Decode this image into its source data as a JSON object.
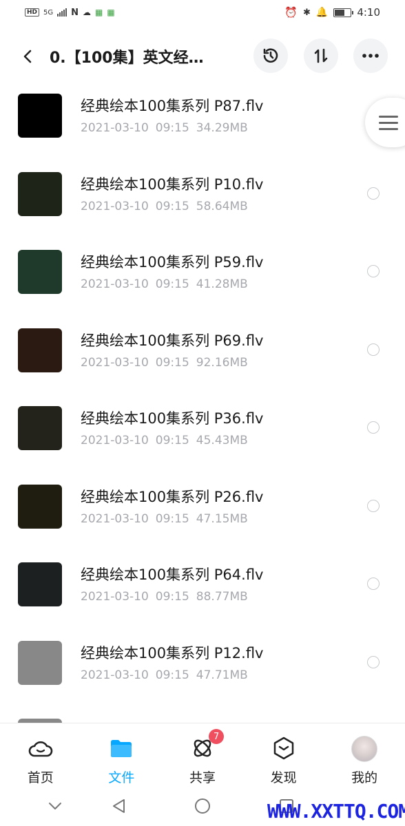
{
  "status_bar": {
    "left_chip": "HD",
    "network": "5G",
    "time": "4:10"
  },
  "header": {
    "back_icon": "chevron-left-icon",
    "title": "0.【100集】英文经…",
    "actions": [
      {
        "name": "history-icon"
      },
      {
        "name": "sort-icon"
      },
      {
        "name": "more-icon"
      }
    ]
  },
  "files": [
    {
      "name": "经典绘本100集系列 P87.flv",
      "date": "2021-03-10",
      "time": "09:15",
      "size": "34.29MB",
      "thumb_color": "#000000"
    },
    {
      "name": "经典绘本100集系列 P10.flv",
      "date": "2021-03-10",
      "time": "09:15",
      "size": "58.64MB",
      "thumb_color": "#1f2419"
    },
    {
      "name": "经典绘本100集系列 P59.flv",
      "date": "2021-03-10",
      "time": "09:15",
      "size": "41.28MB",
      "thumb_color": "#1f3a2a"
    },
    {
      "name": "经典绘本100集系列 P69.flv",
      "date": "2021-03-10",
      "time": "09:15",
      "size": "92.16MB",
      "thumb_color": "#2a1a12"
    },
    {
      "name": "经典绘本100集系列 P36.flv",
      "date": "2021-03-10",
      "time": "09:15",
      "size": "45.43MB",
      "thumb_color": "#23231b"
    },
    {
      "name": "经典绘本100集系列 P26.flv",
      "date": "2021-03-10",
      "time": "09:15",
      "size": "47.15MB",
      "thumb_color": "#1f1d10"
    },
    {
      "name": "经典绘本100集系列 P64.flv",
      "date": "2021-03-10",
      "time": "09:15",
      "size": "88.77MB",
      "thumb_color": "#1c2020"
    },
    {
      "name": "经典绘本100集系列 P12.flv",
      "date": "2021-03-10",
      "time": "09:15",
      "size": "47.71MB",
      "thumb_color": "#888888"
    }
  ],
  "bottom_nav": [
    {
      "label": "首页",
      "icon": "cloud-home-icon",
      "active": false
    },
    {
      "label": "文件",
      "icon": "folder-icon",
      "active": true
    },
    {
      "label": "共享",
      "icon": "share-atom-icon",
      "active": false,
      "badge": "7"
    },
    {
      "label": "发现",
      "icon": "discover-box-icon",
      "active": false
    },
    {
      "label": "我的",
      "icon": "avatar",
      "active": false
    }
  ],
  "watermark": "WWW.XXTTQ.COM",
  "colors": {
    "accent": "#06a7ff",
    "badge": "#f04f5f",
    "meta_text": "#a6a8ad"
  }
}
